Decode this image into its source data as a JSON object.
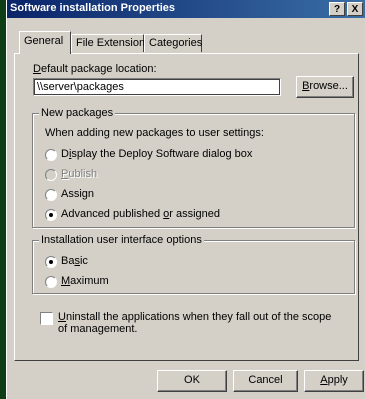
{
  "window": {
    "title": "Software installation Properties",
    "help_glyph": "?",
    "close_glyph": "X"
  },
  "tabs": [
    {
      "label": "General",
      "active": true
    },
    {
      "label": "File Extensions",
      "active": false
    },
    {
      "label": "Categories",
      "active": false
    }
  ],
  "general": {
    "default_location_label_u": "D",
    "default_location_label_rest": "efault package location:",
    "default_location_value": "\\\\server\\packages",
    "browse_label_u": "B",
    "browse_label_rest": "rowse..."
  },
  "new_packages": {
    "title": "New packages",
    "instruction": "When adding new packages to user settings:",
    "options": [
      {
        "pre": "D",
        "u": "i",
        "post": "splay the Deploy Software dialog box",
        "checked": false,
        "disabled": false
      },
      {
        "pre": "",
        "u": "P",
        "post": "ublish",
        "checked": false,
        "disabled": true
      },
      {
        "pre": "Assi",
        "u": "g",
        "post": "n",
        "checked": false,
        "disabled": false
      },
      {
        "pre": "Advanced published ",
        "u": "o",
        "post": "r assigned",
        "checked": true,
        "disabled": false
      }
    ]
  },
  "ui_options": {
    "title": "Installation user interface options",
    "options": [
      {
        "pre": "Ba",
        "u": "s",
        "post": "ic",
        "checked": true
      },
      {
        "pre": "",
        "u": "M",
        "post": "aximum",
        "checked": false
      }
    ]
  },
  "uninstall": {
    "u": "U",
    "rest": "ninstall the applications when they fall out of the scope of management.",
    "checked": false
  },
  "buttons": {
    "ok": "OK",
    "cancel": "Cancel",
    "apply_u": "A",
    "apply_rest": "pply"
  },
  "colors": {
    "face": "#d4d0c8",
    "title_start": "#0a246a",
    "title_end": "#3a6ea5",
    "desktop": "#0f3d15"
  }
}
